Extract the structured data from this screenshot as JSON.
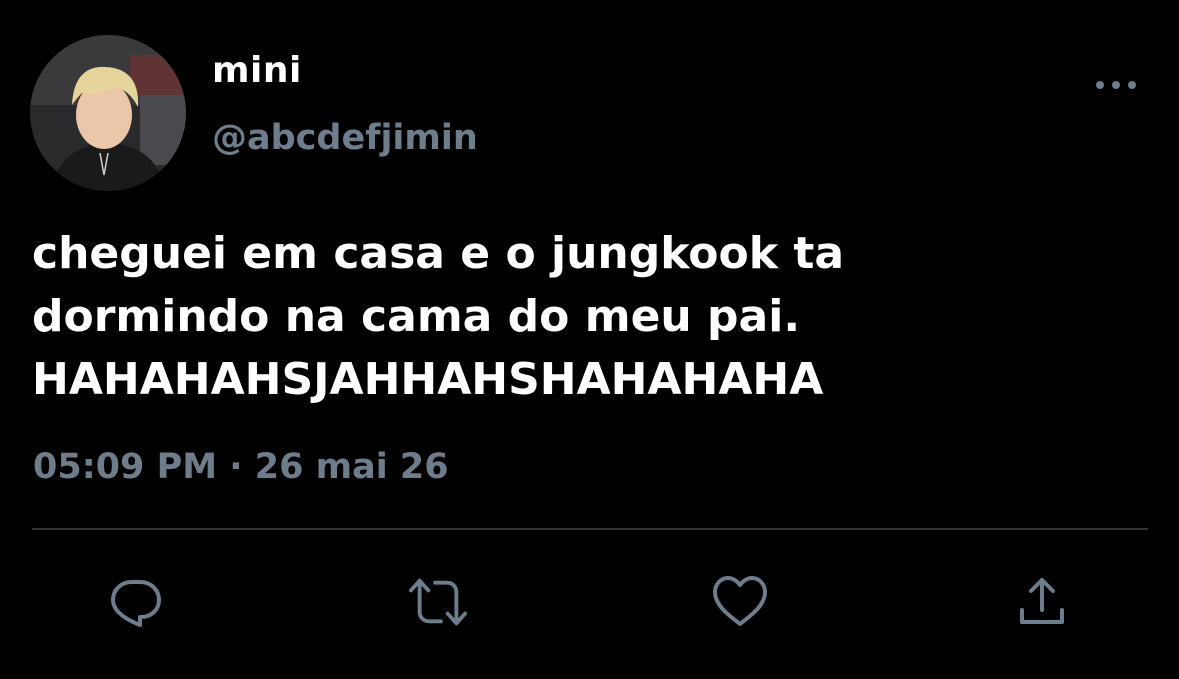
{
  "author": {
    "display_name": "mini",
    "handle": "@abcdefjimin",
    "avatar_icon": "profile-photo"
  },
  "more_icon": "ellipsis-icon",
  "tweet": {
    "lines": [
      "cheguei em casa e o jungkook ta",
      "dormindo na cama do meu pai.",
      "HAHAHAHSJAHHAHSHAHAHAHA"
    ],
    "timestamp": "05:09 PM · 26 mai 26"
  },
  "actions": [
    {
      "name": "reply",
      "icon": "comment-bubble-icon"
    },
    {
      "name": "retweet",
      "icon": "retweet-arrows-icon"
    },
    {
      "name": "like",
      "icon": "heart-icon"
    },
    {
      "name": "share",
      "icon": "share-upload-icon"
    }
  ],
  "colors": {
    "background": "#000000",
    "text_primary": "#ffffff",
    "text_secondary": "#6e7d8b",
    "divider": "#2f3336"
  }
}
